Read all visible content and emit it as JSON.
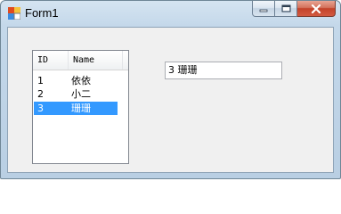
{
  "window": {
    "title": "Form1"
  },
  "listview": {
    "columns": [
      "ID",
      "Name"
    ],
    "rows": [
      {
        "id": "1",
        "name": "依依",
        "selected": false
      },
      {
        "id": "2",
        "name": "小二",
        "selected": false
      },
      {
        "id": "3",
        "name": "珊珊",
        "selected": true
      }
    ]
  },
  "textbox": {
    "value": "3 珊珊"
  },
  "colors": {
    "selection": "#3399ff",
    "client_bg": "#f0f0f0",
    "close_button": "#c3422a"
  },
  "icons": [
    "app-icon",
    "minimize-icon",
    "maximize-icon",
    "close-icon"
  ]
}
